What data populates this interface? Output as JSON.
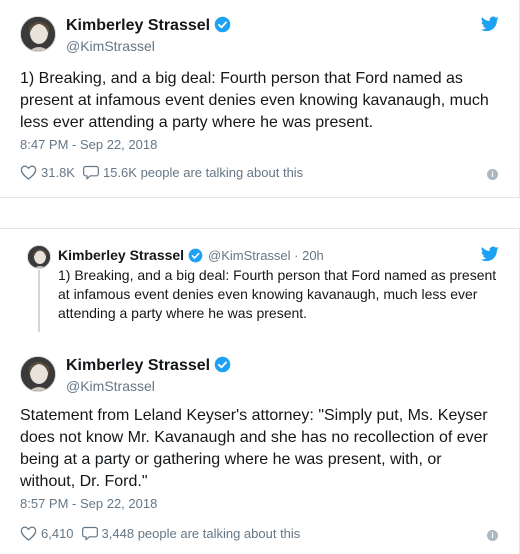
{
  "tweet1": {
    "name": "Kimberley Strassel",
    "handle": "@KimStrassel",
    "text": "1) Breaking, and a big deal: Fourth person that Ford named as present at infamous event denies even knowing kavanaugh, much less ever attending a party where he was present.",
    "timestamp": "8:47 PM - Sep 22, 2018",
    "likes": "31.8K",
    "talking": "15.6K people are talking about this"
  },
  "tweet2": {
    "quoted": {
      "name": "Kimberley Strassel",
      "handle": "@KimStrassel · 20h",
      "text": "1) Breaking, and a big deal: Fourth person that Ford named as present at infamous event denies even knowing kavanaugh, much less ever attending a party where he was present."
    },
    "name": "Kimberley Strassel",
    "handle": "@KimStrassel",
    "text": "Statement from Leland Keyser's attorney: \"Simply put, Ms. Keyser does not know Mr. Kavanaugh and she has no recollection of ever being at a party or gathering where he was present, with, or without, Dr. Ford.\"",
    "timestamp": "8:57 PM - Sep 22, 2018",
    "likes": "6,410",
    "talking": "3,448 people are talking about this"
  },
  "icons": {
    "verified": "verified-badge-icon",
    "bird": "twitter-bird-icon",
    "heart": "heart-icon",
    "reply": "speech-bubble-icon",
    "info": "info-icon"
  },
  "colors": {
    "twitter_blue": "#1da1f2",
    "muted": "#657786",
    "text": "#14171a"
  }
}
